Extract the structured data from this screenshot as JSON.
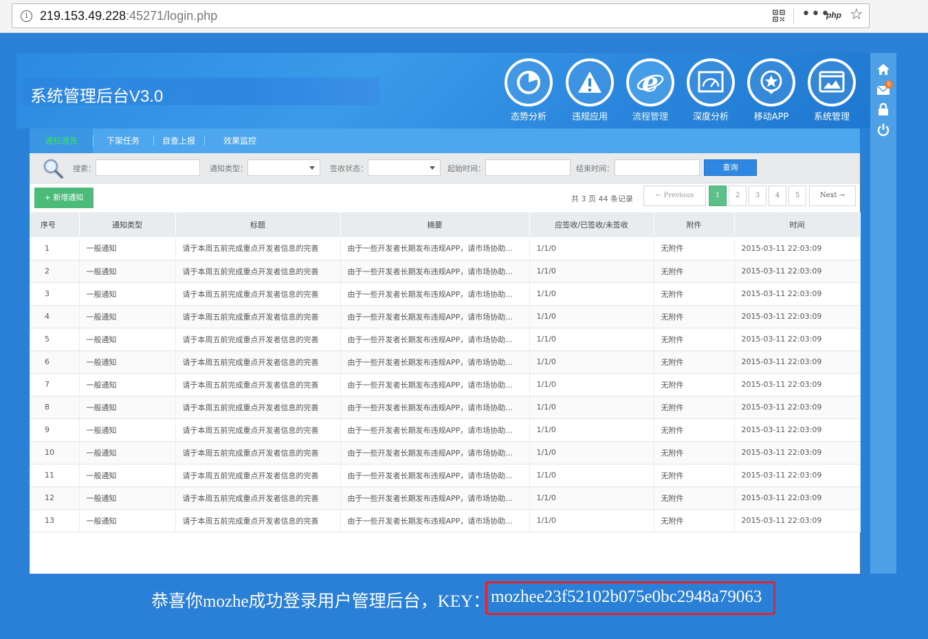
{
  "browser": {
    "url_host": "219.153.49.228",
    "url_rest": ":45271/login.php",
    "php_badge": "php"
  },
  "app": {
    "title": "系统管理后台V3.0",
    "topnav": [
      {
        "label": "态势分析",
        "icon": "pie-chart-icon"
      },
      {
        "label": "违规应用",
        "icon": "warning-icon"
      },
      {
        "label": "流程管理",
        "icon": "ie-icon",
        "active": true
      },
      {
        "label": "深度分析",
        "icon": "gauge-icon"
      },
      {
        "label": "移动APP",
        "icon": "star-badge-icon"
      },
      {
        "label": "系统管理",
        "icon": "window-icon"
      }
    ],
    "rightbar": {
      "mail_badge": "5",
      "icons": [
        "home-icon",
        "mail-icon",
        "lock-icon",
        "power-icon"
      ]
    }
  },
  "tabs": [
    "通知通告",
    "下架任务",
    "自查上报",
    "效果监控"
  ],
  "search": {
    "search_label": "搜索：",
    "type_label": "通知类型：",
    "status_label": "签收状态：",
    "start_label": "起始时间：",
    "end_label": "结束时间：",
    "query_button": "查询"
  },
  "toolbar": {
    "add_button": "+ 新增通知",
    "summary": "共 3 页 44 条记录"
  },
  "pagination": {
    "previous": "← Previous",
    "pages": [
      "1",
      "2",
      "3",
      "4",
      "5"
    ],
    "next": "Next →",
    "active": "1"
  },
  "table": {
    "columns": [
      "序号",
      "通知类型",
      "标题",
      "摘要",
      "应签收/已签收/未签收",
      "附件",
      "时间"
    ],
    "rows": [
      [
        "1",
        "一般通知",
        "请于本周五前完成重点开发者信息的完善",
        "由于一些开发者长期发布违规APP，请市场协助...",
        "1/1/0",
        "无附件",
        "2015-03-11 22:03:09"
      ],
      [
        "2",
        "一般通知",
        "请于本周五前完成重点开发者信息的完善",
        "由于一些开发者长期发布违规APP，请市场协助...",
        "1/1/0",
        "无附件",
        "2015-03-11 22:03:09"
      ],
      [
        "3",
        "一般通知",
        "请于本周五前完成重点开发者信息的完善",
        "由于一些开发者长期发布违规APP，请市场协助...",
        "1/1/0",
        "无附件",
        "2015-03-11 22:03:09"
      ],
      [
        "4",
        "一般通知",
        "请于本周五前完成重点开发者信息的完善",
        "由于一些开发者长期发布违规APP，请市场协助...",
        "1/1/0",
        "无附件",
        "2015-03-11 22:03:09"
      ],
      [
        "5",
        "一般通知",
        "请于本周五前完成重点开发者信息的完善",
        "由于一些开发者长期发布违规APP，请市场协助...",
        "1/1/0",
        "无附件",
        "2015-03-11 22:03:09"
      ],
      [
        "6",
        "一般通知",
        "请于本周五前完成重点开发者信息的完善",
        "由于一些开发者长期发布违规APP，请市场协助...",
        "1/1/0",
        "无附件",
        "2015-03-11 22:03:09"
      ],
      [
        "7",
        "一般通知",
        "请于本周五前完成重点开发者信息的完善",
        "由于一些开发者长期发布违规APP，请市场协助...",
        "1/1/0",
        "无附件",
        "2015-03-11 22:03:09"
      ],
      [
        "8",
        "一般通知",
        "请于本周五前完成重点开发者信息的完善",
        "由于一些开发者长期发布违规APP，请市场协助...",
        "1/1/0",
        "无附件",
        "2015-03-11 22:03:09"
      ],
      [
        "9",
        "一般通知",
        "请于本周五前完成重点开发者信息的完善",
        "由于一些开发者长期发布违规APP，请市场协助...",
        "1/1/0",
        "无附件",
        "2015-03-11 22:03:09"
      ],
      [
        "10",
        "一般通知",
        "请于本周五前完成重点开发者信息的完善",
        "由于一些开发者长期发布违规APP，请市场协助...",
        "1/1/0",
        "无附件",
        "2015-03-11 22:03:09"
      ],
      [
        "11",
        "一般通知",
        "请于本周五前完成重点开发者信息的完善",
        "由于一些开发者长期发布违规APP，请市场协助...",
        "1/1/0",
        "无附件",
        "2015-03-11 22:03:09"
      ],
      [
        "12",
        "一般通知",
        "请于本周五前完成重点开发者信息的完善",
        "由于一些开发者长期发布违规APP，请市场协助...",
        "1/1/0",
        "无附件",
        "2015-03-11 22:03:09"
      ],
      [
        "13",
        "一般通知",
        "请于本周五前完成重点开发者信息的完善",
        "由于一些开发者长期发布违规APP，请市场协助...",
        "1/1/0",
        "无附件",
        "2015-03-11 22:03:09"
      ]
    ]
  },
  "footer": {
    "message": "恭喜你mozhe成功登录用户管理后台，KEY：",
    "key": "mozhee23f52102b075e0bc2948a79063"
  },
  "colors": {
    "page_bg": "#2a7fd6",
    "tab_bar": "#4ea6ee",
    "active_tab_text": "#37e45a",
    "add_button": "#4cbb7a",
    "query_button": "#2e87e0",
    "key_highlight": "#e3242b"
  }
}
